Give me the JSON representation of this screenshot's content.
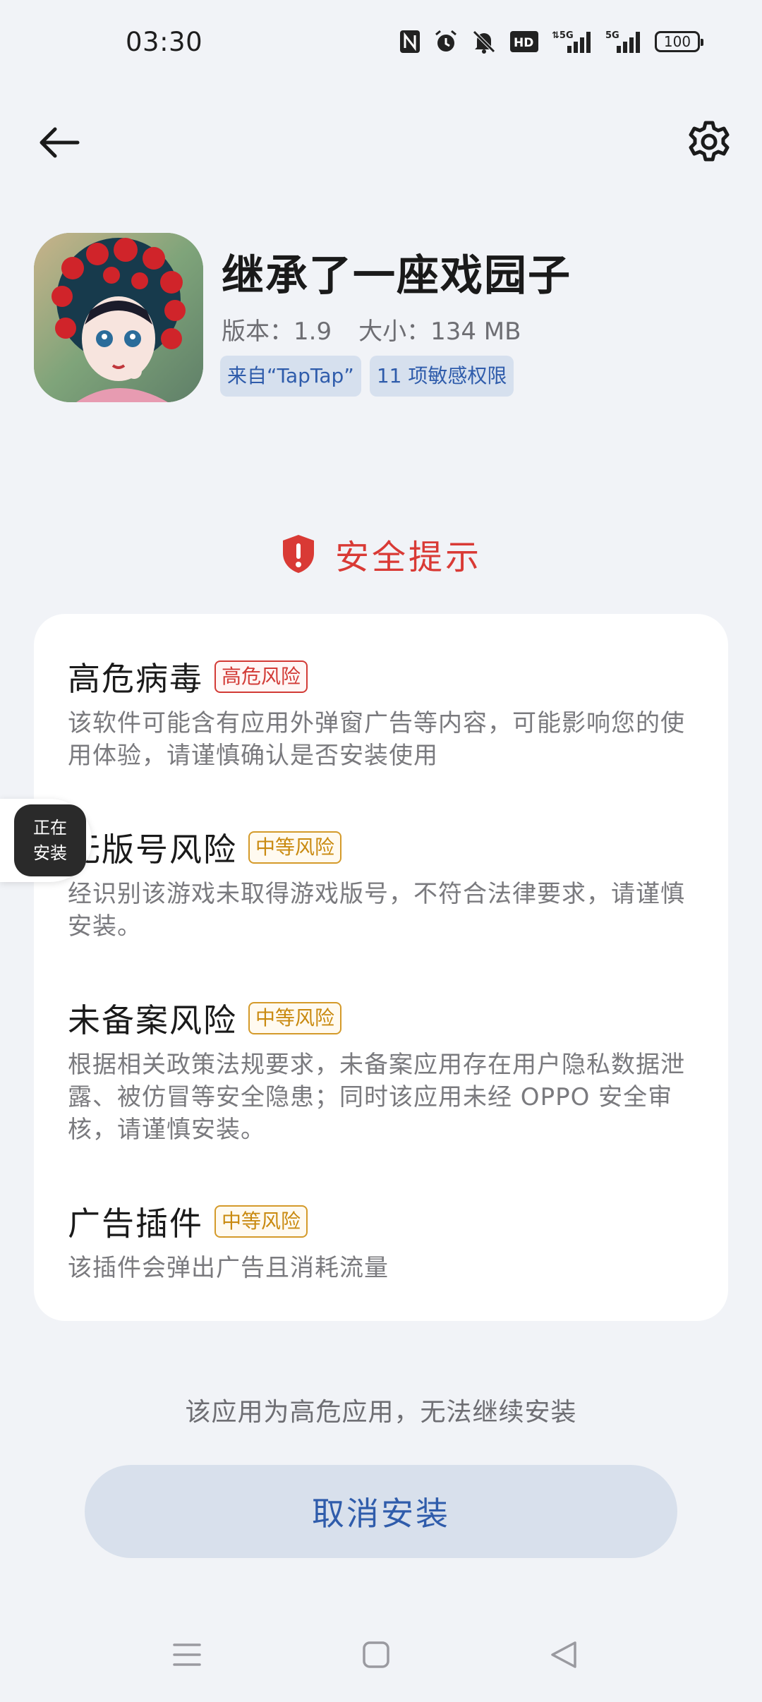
{
  "status_bar": {
    "time": "03:30",
    "icons": [
      "nfc-icon",
      "alarm-icon",
      "mute-icon",
      "hd-icon",
      "5g-signal-icon",
      "5g-signal-icon-2"
    ],
    "battery": "100"
  },
  "app": {
    "name": "继承了一座戏园子",
    "version": "版本：1.9",
    "size": "大小：134 MB",
    "tags": [
      "来自“TapTap”",
      "11 项敏感权限"
    ]
  },
  "security": {
    "title": "安全提示",
    "risks": [
      {
        "title": "高危病毒",
        "badge": "高危风险",
        "level": "high",
        "desc": "该软件可能含有应用外弹窗广告等内容，可能影响您的使用体验，请谨慎确认是否安装使用"
      },
      {
        "title": "无版号风险",
        "badge": "中等风险",
        "level": "medium",
        "desc": "经识别该游戏未取得游戏版号，不符合法律要求，请谨慎安装。"
      },
      {
        "title": "未备案风险",
        "badge": "中等风险",
        "level": "medium",
        "desc": "根据相关政策法规要求，未备案应用存在用户隐私数据泄露、被仿冒等安全隐患；同时该应用未经 OPPO 安全审核，请谨慎安装。"
      },
      {
        "title": "广告插件",
        "badge": "中等风险",
        "level": "medium",
        "desc": "该插件会弹出广告且消耗流量"
      }
    ]
  },
  "floating": {
    "line1": "正在",
    "line2": "安装"
  },
  "footer": {
    "note": "该应用为高危应用，无法继续安装",
    "cancel_label": "取消安装"
  },
  "colors": {
    "danger": "#d93a35",
    "warning": "#c98a10",
    "accent": "#2f5cab",
    "background": "#f1f3f7"
  }
}
